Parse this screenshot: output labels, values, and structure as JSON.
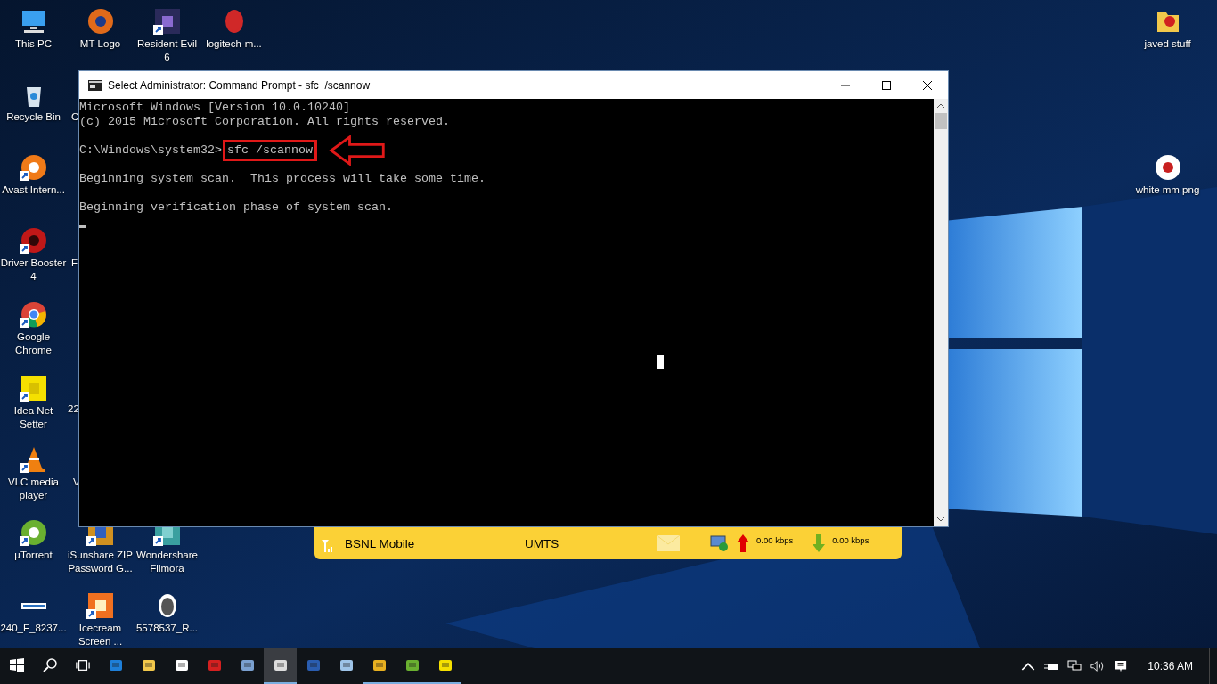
{
  "desktop": {
    "icons": [
      {
        "label": "This PC",
        "shortcut": false
      },
      {
        "label": "MT-Logo",
        "shortcut": false
      },
      {
        "label": "Resident Evil 6",
        "shortcut": true
      },
      {
        "label": "logitech-m...",
        "shortcut": false
      },
      {
        "label": "Recycle Bin",
        "shortcut": false
      },
      {
        "label": "Avast Intern...",
        "shortcut": true
      },
      {
        "label": "Driver Booster 4",
        "shortcut": true
      },
      {
        "label": "Google Chrome",
        "shortcut": true
      },
      {
        "label": "Idea Net Setter",
        "shortcut": true
      },
      {
        "label": "VLC media player",
        "shortcut": true
      },
      {
        "label": "µTorrent",
        "shortcut": true
      },
      {
        "label": "iSunshare ZIP Password G...",
        "shortcut": true
      },
      {
        "label": "Wondershare Filmora",
        "shortcut": true
      },
      {
        "label": "240_F_8237...",
        "shortcut": false
      },
      {
        "label": "Icecream Screen ...",
        "shortcut": true
      },
      {
        "label": "5578537_R...",
        "shortcut": false
      },
      {
        "label": "javed stuff",
        "shortcut": false
      },
      {
        "label": "white mm png",
        "shortcut": false
      }
    ],
    "hidden_labels": [
      "C",
      "F",
      "22",
      "V"
    ]
  },
  "window": {
    "title": "Select Administrator: Command Prompt - sfc  /scannow",
    "lines": [
      {
        "kind": "output",
        "text": "Microsoft Windows [Version 10.0.10240]"
      },
      {
        "kind": "output",
        "text": "(c) 2015 Microsoft Corporation. All rights reserved."
      },
      {
        "kind": "blank"
      },
      {
        "kind": "prompt",
        "prompt": "C:\\Windows\\system32>",
        "command": "sfc /scannow",
        "highlighted": true
      },
      {
        "kind": "blank"
      },
      {
        "kind": "output",
        "text": "Beginning system scan.  This process will take some time."
      },
      {
        "kind": "blank"
      },
      {
        "kind": "output",
        "text": "Beginning verification phase of system scan."
      },
      {
        "kind": "cursor"
      }
    ]
  },
  "network_bar": {
    "operator": "BSNL Mobile",
    "mode": "UMTS",
    "upload": "0.00 kbps",
    "download": "0.00 kbps"
  },
  "taskbar": {
    "items": [
      {
        "kind": "start",
        "running": false,
        "selected": false
      },
      {
        "kind": "search",
        "running": false,
        "selected": false
      },
      {
        "kind": "taskview",
        "running": false,
        "selected": false
      },
      {
        "kind": "app",
        "running": false,
        "selected": false
      },
      {
        "kind": "app",
        "running": false,
        "selected": false
      },
      {
        "kind": "app",
        "running": false,
        "selected": false
      },
      {
        "kind": "app",
        "running": false,
        "selected": false
      },
      {
        "kind": "app",
        "running": false,
        "selected": false
      },
      {
        "kind": "app",
        "running": true,
        "selected": true
      },
      {
        "kind": "app",
        "running": false,
        "selected": false
      },
      {
        "kind": "app",
        "running": false,
        "selected": false
      },
      {
        "kind": "app",
        "running": true,
        "selected": false
      },
      {
        "kind": "app",
        "running": true,
        "selected": false
      },
      {
        "kind": "app",
        "running": true,
        "selected": false
      }
    ],
    "clock": "10:36 AM"
  }
}
